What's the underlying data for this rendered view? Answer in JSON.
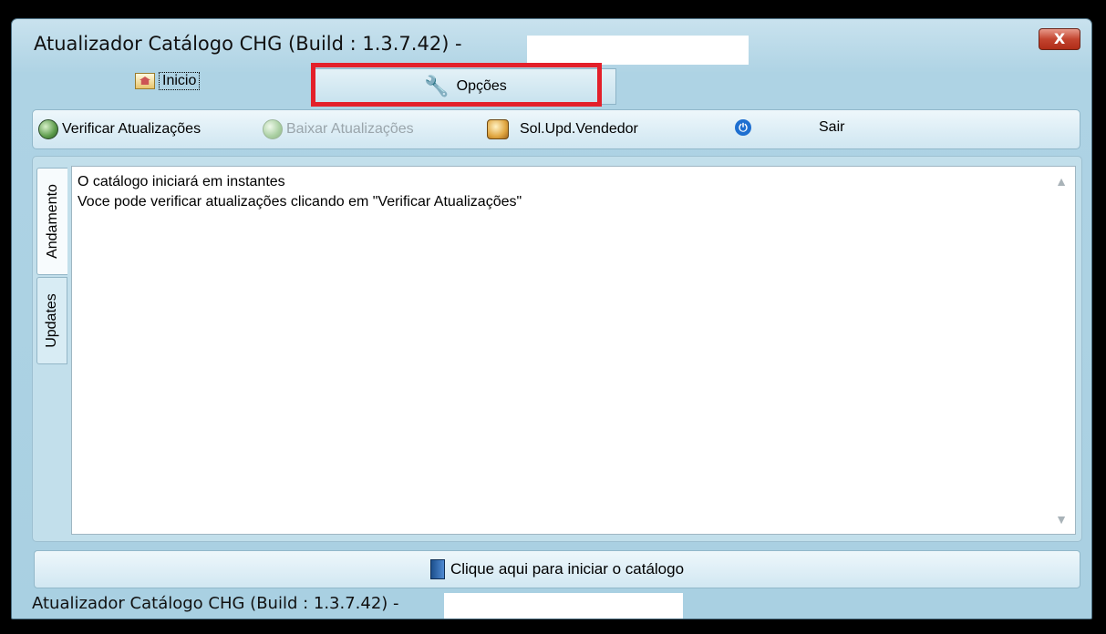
{
  "window": {
    "title": "Atualizador Catálogo CHG  (Build : 1.3.7.42) -",
    "close_label": "X"
  },
  "tabs": {
    "inicio_label": "Inicio",
    "opcoes_label": "Opções"
  },
  "toolbar": {
    "verificar_label": "Verificar Atualizações",
    "baixar_label": "Baixar Atualizações",
    "sol_upd_label": "Sol.Upd.Vendedor",
    "sair_label": "Sair"
  },
  "side_tabs": {
    "andamento_label": "Andamento",
    "updates_label": "Updates"
  },
  "log": {
    "line1": "O catálogo iniciará em instantes",
    "line2": "Voce pode verificar atualizações clicando em \"Verificar Atualizações\""
  },
  "start_button": {
    "label": "Clique aqui para iniciar o catálogo"
  },
  "statusbar": {
    "text": "Atualizador Catálogo CHG  (Build : 1.3.7.42) -"
  },
  "colors": {
    "highlight": "#e3202a",
    "window_bg": "#aed3e4"
  }
}
